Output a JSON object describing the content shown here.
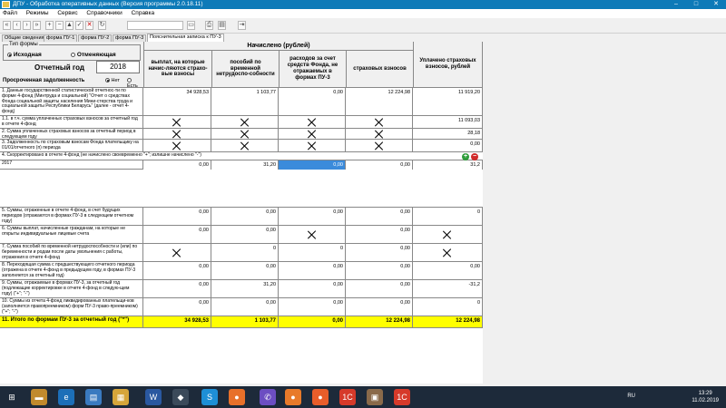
{
  "window": {
    "title": "ДПУ - Обработка оперативных данных (Версия программы 2.0.18.11)",
    "controls": [
      "–",
      "□",
      "✕"
    ]
  },
  "menu": [
    "Файл",
    "Режимы",
    "Сервис",
    "Справочники",
    "Справка"
  ],
  "tabs": [
    "Общие сведения",
    "форма ПУ-1",
    "форма ПУ-2",
    "форма ПУ-3",
    "Пояснительная записка к ПУ-3"
  ],
  "active_tab": 4,
  "form": {
    "type_label": "Тип формы",
    "type_initial": "Исходная",
    "type_corrective": "Отменяющая",
    "year_label": "Отчетный год",
    "year_value": "2018",
    "arrears_label": "Просроченная задолженность",
    "arrears_no": "Нет",
    "arrears_yes": "Есть"
  },
  "header": {
    "accrued": "Начислено (рублей)",
    "col1": "выплат, на которые начис-ляются страхо-вые взносы",
    "col2": "пособий по временной нетрудоспо-собности",
    "col3": "расходов за счет средств Фонда, не отражаемых в формах ПУ-3",
    "col4": "страховых взносов",
    "col5": "Уплачено страховых взносов, рублей"
  },
  "rows": [
    {
      "label": "1. Данные государственной статистической отчетнос-ти по форме 4-фонд (Минтруда и социальной) \"Отчет о средствах Фонда социальной защиты населения Мини-стерства труда и социальной защиты Республики Беларусь\" (далее - отчет 4-фонд)",
      "c1": "34 928,53",
      "c2": "1 103,77",
      "c3": "0,00",
      "c4": "12 224,98",
      "c5": "11 919,20"
    },
    {
      "label": "1.1. в т.ч. сумма уплаченных страховых взносов за отчетный год в отчете 4-фонд",
      "c5": "11 093,03"
    },
    {
      "label": "2. Сумма уплаченных страховых взносов за отчетный период в следующем году",
      "c5": "28,18"
    },
    {
      "label": "3. Задолженность по страховым взносам Фонда плательщику на 01/01/отчетного (п) периода",
      "c5": "0,00"
    },
    {
      "label": "4. Скорректировано в отчете 4-фонд (не начислено своевременно \"+\"; излишне начислено \"-\")"
    },
    {
      "label": "2017",
      "c1": "0,00",
      "c2": "31,20",
      "c3": "0,00",
      "c4": "0,00",
      "c5": "31,2"
    },
    {
      "label": "5. Суммы, отраженные в отчете 4-фонд, в счет будущих периодов (отражаются в формах ПУ-3 в следующем отчетном году)",
      "c1": "0,00",
      "c2": "0,00",
      "c3": "0,00",
      "c4": "0,00",
      "c5": "0"
    },
    {
      "label": "6. Суммы выплат, начисленные гражданам, на которые не открыты индивидуальные лицевые счета",
      "c1": "0,00",
      "c2": "0,00",
      "c4": "0,00"
    },
    {
      "label": "7. Сумма пособий по временной нетрудоспособности и (или) по беременности и родам после даты увольнения с работы, отражения в отчете 4-фонд",
      "c2": "0",
      "c3": "0",
      "c4": "0,00"
    },
    {
      "label": "8. Переходящая сумма с предшествующего отчетного периода (отражена в отчете 4-фонд в предыдущем году, в формах ПУ-3 заполняется за отчетный год)",
      "c1": "0,00",
      "c2": "0,00",
      "c3": "0,00",
      "c4": "0,00",
      "c5": "0,00"
    },
    {
      "label": "9. Суммы, отражаемые в формах ПУ-3, за отчетный год (подлежащие корректировке в отчете 4-фонд в следую-щем году) (\"+\"; \"-\")",
      "c1": "0,00",
      "c2": "31,20",
      "c3": "0,00",
      "c4": "0,00",
      "c5": "-31,2"
    },
    {
      "label": "10. Суммы из отчета 4-фонд ликвидированных плательщи-ков (заполняется правопреемником) форм ПУ-3 право-преемником) (\"+\"; \"-\")",
      "c1": "0,00",
      "c2": "0,00",
      "c3": "0,00",
      "c4": "0,00",
      "c5": "0"
    },
    {
      "label": "11. Итого по формам ПУ-3 за отчетный год (\"*\")",
      "c1": "34 928,53",
      "c2": "1 103,77",
      "c3": "0,00",
      "c4": "12 224,98",
      "c5": "12 224,98"
    }
  ],
  "buttons": {
    "add": "+",
    "remove": "−"
  },
  "taskbar": {
    "lang": "RU",
    "time": "13:29",
    "date": "11.02.2019"
  }
}
